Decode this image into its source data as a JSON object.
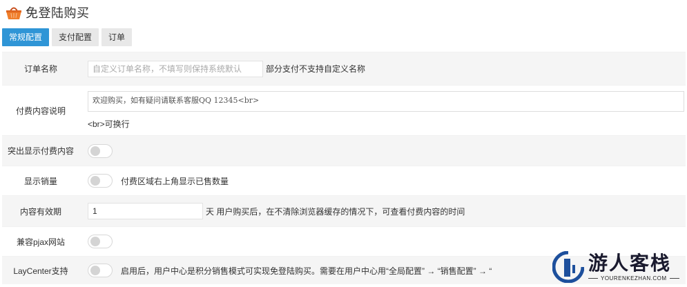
{
  "header": {
    "title": "免登陆购买",
    "icon": "basket-icon"
  },
  "tabs": [
    {
      "label": "常规配置",
      "active": true
    },
    {
      "label": "支付配置",
      "active": false
    },
    {
      "label": "订单",
      "active": false
    }
  ],
  "form": {
    "order_name": {
      "label": "订单名称",
      "placeholder": "自定义订单名称，不填写则保持系统默认",
      "help": "部分支付不支持自定义名称"
    },
    "content_desc": {
      "label": "付费内容说明",
      "value": "欢迎购买，如有疑问请联系客服QQ 12345<br>",
      "note": "<br>可换行"
    },
    "highlight": {
      "label": "突出显示付费内容",
      "on": false
    },
    "show_sales": {
      "label": "显示销量",
      "on": false,
      "text": "付费区域右上角显示已售数量"
    },
    "validity": {
      "label": "内容有效期",
      "value": "1",
      "help": "天 用户购买后，在不清除浏览器缓存的情况下，可查看付费内容的时间"
    },
    "pjax": {
      "label": "兼容pjax网站",
      "on": false
    },
    "laycenter": {
      "label": "LayCenter支持",
      "on": false,
      "text": "启用后，用户中心是积分销售模式可实现免登陆购买。需要在用户中心用“全局配置” → “销售配置” → “"
    }
  },
  "watermark": {
    "main": "游人客栈",
    "sub": "YOURENKEZHAN.COM"
  },
  "colors": {
    "accent": "#2f95d6",
    "row_alt": "#f5f5f5"
  }
}
